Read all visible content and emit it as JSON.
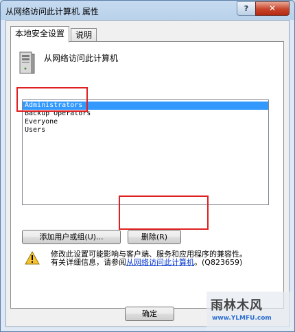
{
  "window": {
    "title": "从网络访问此计算机 属性",
    "help_glyph": "?",
    "close_glyph": "✕"
  },
  "tabs": [
    {
      "label": "本地安全设置",
      "active": true
    },
    {
      "label": "说明",
      "active": false
    }
  ],
  "panel": {
    "heading": "从网络访问此计算机",
    "members": [
      {
        "name": "Administrators",
        "selected": true
      },
      {
        "name": "Backup Operators",
        "selected": false
      },
      {
        "name": "Everyone",
        "selected": false
      },
      {
        "name": "Users",
        "selected": false
      }
    ],
    "add_button": "添加用户或组(U)...",
    "remove_button": "删除(R)",
    "warning_line1": "修改此设置可能影响与客户端、服务和应用程序的兼容性。",
    "warning_line2_prefix": "有关详细信息，请参阅",
    "warning_link": "从网络访问此计算机",
    "warning_suffix": "。(Q823659)"
  },
  "footer": {
    "ok_button": "确定"
  },
  "watermark": {
    "logo": "雨林木风",
    "url": "www.YLMFU.com"
  },
  "colors": {
    "selection": "#3399ff",
    "annotation_red": "#e02020",
    "link": "#0033cc"
  }
}
